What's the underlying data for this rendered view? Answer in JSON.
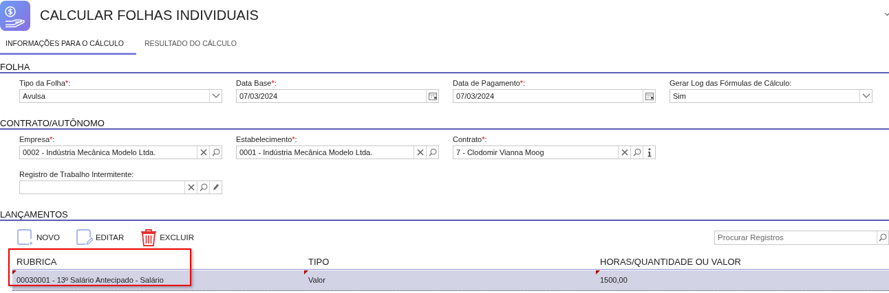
{
  "header": {
    "title": "CALCULAR FOLHAS INDIVIDUAIS"
  },
  "tabs": [
    {
      "label": "INFORMAÇÕES PARA O CÁLCULO",
      "selected": true
    },
    {
      "label": "RESULTADO DO CÁLCULO",
      "selected": false
    }
  ],
  "sections": [
    {
      "title": "FOLHA",
      "rows": [
        [
          {
            "label": "Tipo da Folha",
            "required_mark": "*",
            "suffix": ":",
            "kind": "select",
            "value": "Avulsa"
          },
          {
            "label": "Data Base",
            "required_mark": "*",
            "suffix": ":",
            "kind": "date",
            "value": "07/03/2024"
          },
          {
            "label": "Data de Pagamento",
            "required_mark": "*",
            "suffix": ":",
            "kind": "date",
            "value": "07/03/2024"
          },
          {
            "label": "Gerar Log das Fórmulas de Cálculo",
            "suffix": ":",
            "kind": "select",
            "value": "Sim"
          }
        ]
      ]
    },
    {
      "title": "CONTRATO/AUTÔNOMO",
      "rows": [
        [
          {
            "label": "Empresa",
            "required_mark": "*",
            "suffix": ":",
            "kind": "lookup",
            "value": "0002 - Indústria Mecânica Modelo Ltda."
          },
          {
            "label": "Estabelecimento",
            "required_mark": "*",
            "suffix": ":",
            "kind": "lookup",
            "value": "0001 - Indústria Mecânica Modelo Ltda."
          },
          {
            "label": "Contrato",
            "required_mark": "*",
            "suffix": ":",
            "kind": "lookup-info",
            "value": "7 - Clodomir Vianna Moog"
          }
        ],
        [
          {
            "label": "Registro de Trabalho Intermitente",
            "suffix": ":",
            "kind": "lookup-edit"
          }
        ]
      ]
    }
  ],
  "launches": {
    "title": "LANÇAMENTOS",
    "actions": [
      {
        "label": "NOVO",
        "kind": "new"
      },
      {
        "label": "EDITAR",
        "kind": "edit"
      },
      {
        "label": "EXCLUIR",
        "kind": "delete"
      }
    ],
    "search": {
      "placeholder": "Procurar Registros"
    },
    "columns": [
      {
        "label": "RUBRICA",
        "highlighted": true
      },
      {
        "label": "TIPO"
      },
      {
        "label": "HORAS/QUANTIDADE OU VALOR"
      }
    ],
    "rows": [
      {
        "selected": true,
        "cells": [
          "00030001 - 13º Salário Antecipado - Salário",
          "Valor",
          "1500,00"
        ]
      }
    ]
  }
}
